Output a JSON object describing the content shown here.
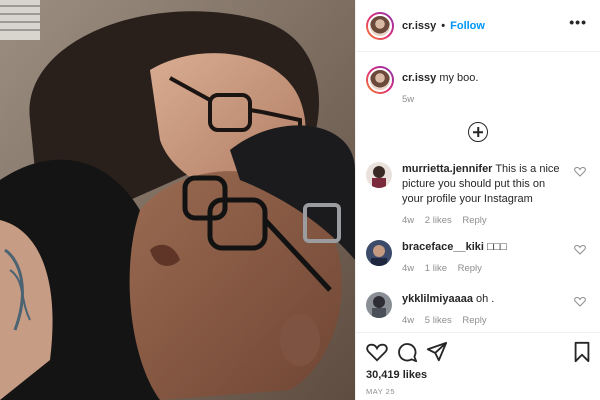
{
  "header": {
    "username": "cr.issy",
    "separator": "•",
    "follow_label": "Follow",
    "more_icon": "more-horizontal-icon",
    "more_glyph": "•••"
  },
  "caption": {
    "username": "cr.issy",
    "text": "my boo.",
    "time": "5w"
  },
  "load_more_icon": "plus-circle-icon",
  "comments": [
    {
      "username": "murrietta.jennifer",
      "text": "This is a nice picture you should put this on your profile your Instagram",
      "time": "4w",
      "likes": "2 likes",
      "reply_label": "Reply"
    },
    {
      "username": "braceface__kiki",
      "text": "□□□",
      "time": "4w",
      "likes": "1 like",
      "reply_label": "Reply"
    },
    {
      "username": "ykklilmiyaaaa",
      "text": "oh .",
      "time": "4w",
      "likes": "5 likes",
      "reply_label": "Reply"
    }
  ],
  "actions": {
    "icons": [
      "heart-icon",
      "comment-icon",
      "share-icon",
      "bookmark-icon"
    ]
  },
  "likes_count": "30,419 likes",
  "date": "MAY 25",
  "colors": {
    "link_blue": "#0095f6",
    "text": "#262626",
    "muted": "#8e8e8e",
    "border": "#efefef"
  }
}
